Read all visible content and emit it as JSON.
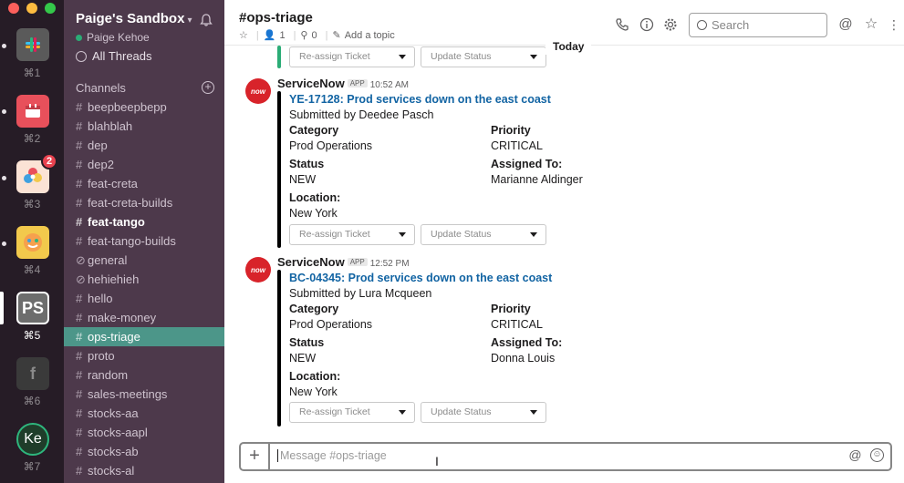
{
  "window_controls": {
    "close": "#fc605c",
    "minimize": "#fdbc40",
    "maximize": "#34c84a"
  },
  "workspaces": [
    {
      "initials": "",
      "key": "⌘1",
      "color": "#6b6b6b",
      "icon": "slack-logo-icon"
    },
    {
      "initials": "",
      "key": "⌘2",
      "color": "#e8505b",
      "icon": "calendar-app-icon"
    },
    {
      "initials": "",
      "key": "⌘3",
      "color": "#f07a3b",
      "icon": "pinwheel-logo-icon",
      "badge": "2"
    },
    {
      "initials": "",
      "key": "⌘4",
      "color": "#f2c94c",
      "icon": "smiley-logo-icon"
    },
    {
      "initials": "PS",
      "key": "⌘5",
      "color": "#6d6d6d"
    },
    {
      "initials": "f",
      "key": "⌘6",
      "color": "#3a3a3a"
    },
    {
      "initials": "Ke",
      "key": "⌘7",
      "color": "#1f6b3a"
    }
  ],
  "sidebar": {
    "team_name": "Paige's Sandbox",
    "user_name": "Paige Kehoe",
    "all_threads": "All Threads",
    "channels_header": "Channels",
    "channels": [
      {
        "name": "beepbeepbepp",
        "type": "channel"
      },
      {
        "name": "blahblah",
        "type": "channel"
      },
      {
        "name": "dep",
        "type": "channel"
      },
      {
        "name": "dep2",
        "type": "channel"
      },
      {
        "name": "feat-creta",
        "type": "channel"
      },
      {
        "name": "feat-creta-builds",
        "type": "channel"
      },
      {
        "name": "feat-tango",
        "type": "channel",
        "bold": true
      },
      {
        "name": "feat-tango-builds",
        "type": "channel"
      },
      {
        "name": "general",
        "type": "shared"
      },
      {
        "name": "hehiehieh",
        "type": "shared"
      },
      {
        "name": "hello",
        "type": "channel"
      },
      {
        "name": "make-money",
        "type": "channel"
      },
      {
        "name": "ops-triage",
        "type": "channel",
        "active": true
      },
      {
        "name": "proto",
        "type": "channel"
      },
      {
        "name": "random",
        "type": "channel"
      },
      {
        "name": "sales-meetings",
        "type": "channel"
      },
      {
        "name": "stocks-aa",
        "type": "channel"
      },
      {
        "name": "stocks-aapl",
        "type": "channel"
      },
      {
        "name": "stocks-ab",
        "type": "channel"
      },
      {
        "name": "stocks-al",
        "type": "channel"
      }
    ]
  },
  "header": {
    "channel_title": "#ops-triage",
    "members": "1",
    "pins": "0",
    "add_topic": "Add a topic",
    "search_placeholder": "Search"
  },
  "divider": {
    "today": "Today"
  },
  "prev_message": {
    "reassign": "Re-assign Ticket",
    "update": "Update Status"
  },
  "messages": [
    {
      "sender": "ServiceNow",
      "app_badge": "APP",
      "time": "10:52 AM",
      "avatar_text": "now",
      "ticket": "YE-17128: Prod services down on the east coast",
      "submitted_by": "Submitted by Deedee Pasch",
      "category_label": "Category",
      "category": "Prod Operations",
      "priority_label": "Priority",
      "priority": "CRITICAL",
      "status_label": "Status",
      "status": "NEW",
      "assigned_label": "Assigned To:",
      "assigned": "Marianne Aldinger",
      "location_label": "Location:",
      "location": "New York",
      "reassign": "Re-assign Ticket",
      "update": "Update Status"
    },
    {
      "sender": "ServiceNow",
      "app_badge": "APP",
      "time": "12:52 PM",
      "avatar_text": "now",
      "ticket": "BC-04345: Prod services down on the east coast",
      "submitted_by": "Submitted by Lura Mcqueen",
      "category_label": "Category",
      "category": "Prod Operations",
      "priority_label": "Priority",
      "priority": "CRITICAL",
      "status_label": "Status",
      "status": "NEW",
      "assigned_label": "Assigned To:",
      "assigned": "Donna Louis",
      "location_label": "Location:",
      "location": "New York",
      "reassign": "Re-assign Ticket",
      "update": "Update Status"
    }
  ],
  "composer": {
    "placeholder": "Message #ops-triage"
  }
}
